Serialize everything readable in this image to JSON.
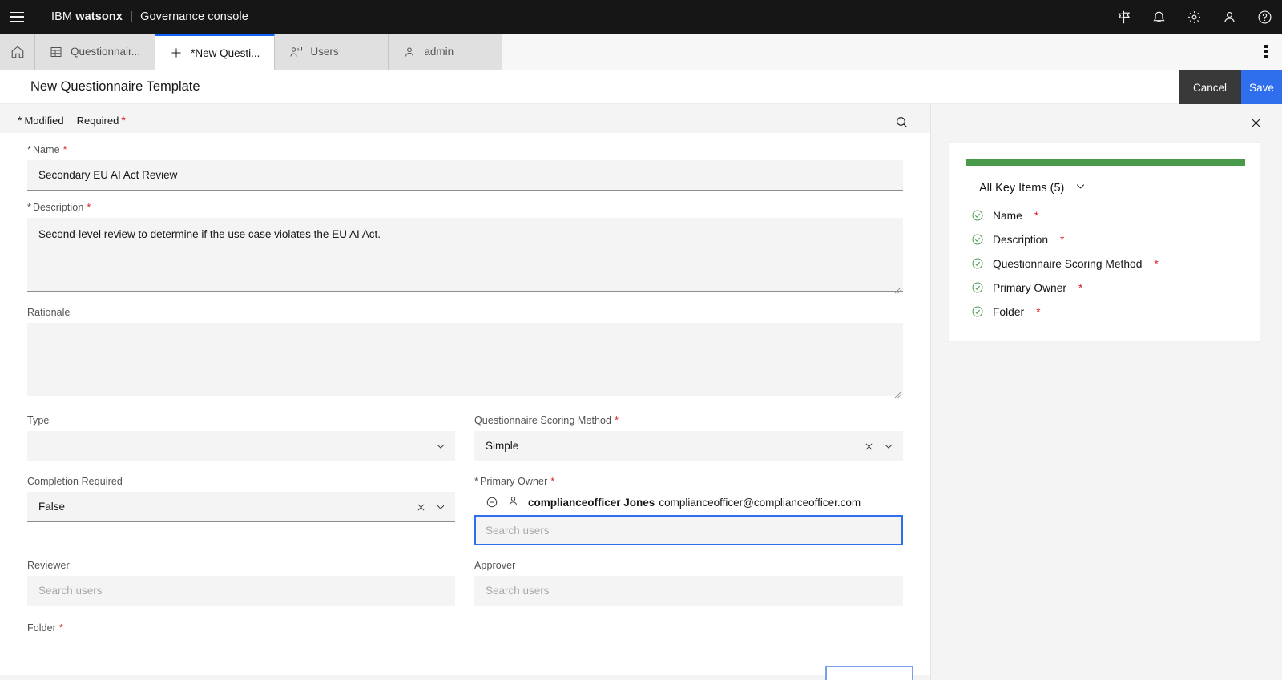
{
  "topbar": {
    "menu_icon": "hamburger-menu-icon",
    "brand_prefix": "IBM",
    "brand_product": "watsonx",
    "brand_separator": "|",
    "brand_console": "Governance console",
    "icons": [
      "signpost-icon",
      "notification-bell-icon",
      "settings-gear-icon",
      "user-avatar-icon",
      "help-question-icon"
    ]
  },
  "tabs": {
    "home_icon": "home-icon",
    "items": [
      {
        "label": "Questionnair...",
        "icon": "table-icon",
        "active": false
      },
      {
        "label": "*New Questi...",
        "icon": "plus-icon",
        "active": true
      },
      {
        "label": "Users",
        "icon": "user-analytics-icon",
        "active": false
      },
      {
        "label": "admin",
        "icon": "user-icon",
        "active": false
      }
    ],
    "overflow_icon": "overflow-menu-icon"
  },
  "page": {
    "title": "New Questionnaire Template",
    "cancel_label": "Cancel",
    "save_label": "Save"
  },
  "legend": {
    "modified_asterisk": "*",
    "modified_label": "Modified",
    "required_label": "Required",
    "required_asterisk": "*",
    "search_icon": "search-icon"
  },
  "form": {
    "name": {
      "label": "Name",
      "pre_asterisk": "*",
      "post_asterisk": "*",
      "value": "Secondary EU AI Act Review"
    },
    "description": {
      "label": "Description",
      "pre_asterisk": "*",
      "post_asterisk": "*",
      "value": "Second-level review to determine if the use case violates the EU AI Act."
    },
    "rationale": {
      "label": "Rationale",
      "value": ""
    },
    "type": {
      "label": "Type",
      "value": "",
      "chevron_icon": "chevron-down-icon"
    },
    "scoring_method": {
      "label": "Questionnaire Scoring Method",
      "post_asterisk": "*",
      "value": "Simple",
      "clear_icon": "clear-x-icon",
      "chevron_icon": "chevron-down-icon"
    },
    "completion_required": {
      "label": "Completion Required",
      "value": "False",
      "clear_icon": "clear-x-icon",
      "chevron_icon": "chevron-down-icon"
    },
    "primary_owner": {
      "label": "Primary Owner",
      "pre_asterisk": "*",
      "post_asterisk": "*",
      "chip_name": "complianceofficer Jones",
      "chip_email": "complianceofficer@complianceofficer.com",
      "remove_icon": "remove-circle-icon",
      "person_icon": "user-icon",
      "placeholder": "Search users",
      "value": ""
    },
    "reviewer": {
      "label": "Reviewer",
      "placeholder": "Search users",
      "value": ""
    },
    "approver": {
      "label": "Approver",
      "placeholder": "Search users",
      "value": ""
    },
    "folder": {
      "label": "Folder",
      "post_asterisk": "*"
    }
  },
  "panel": {
    "close_icon": "close-icon",
    "progress_color": "#4a9a4c",
    "summary_label": "All Key Items (5)",
    "summary_chevron": "chevron-down-icon",
    "items": [
      {
        "label": "Name",
        "asterisk": "*",
        "status_icon": "checkmark-outline-icon"
      },
      {
        "label": "Description",
        "asterisk": "*",
        "status_icon": "checkmark-outline-icon"
      },
      {
        "label": "Questionnaire Scoring Method",
        "asterisk": "*",
        "status_icon": "checkmark-outline-icon"
      },
      {
        "label": "Primary Owner",
        "asterisk": "*",
        "status_icon": "checkmark-outline-icon"
      },
      {
        "label": "Folder",
        "asterisk": "*",
        "status_icon": "checkmark-outline-icon"
      }
    ]
  },
  "colors": {
    "brand_black": "#161616",
    "accent_blue": "#0f62fe",
    "save_blue": "#2f6fed",
    "required_red": "#da1e28",
    "success_green": "#4a9a4c"
  }
}
